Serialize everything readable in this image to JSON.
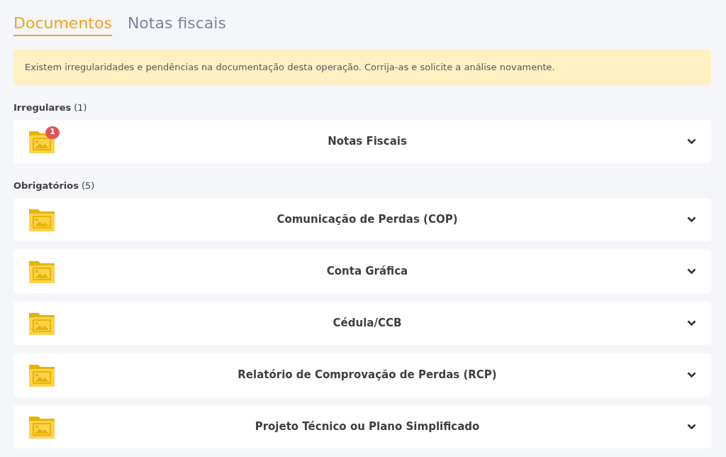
{
  "tabs": [
    {
      "label": "Documentos",
      "selected": true
    },
    {
      "label": "Notas fiscais",
      "selected": false
    }
  ],
  "alert": "Existem irregularidades e pendências na documentação desta operação. Corrija-as e solicite a análise novamente.",
  "sections": [
    {
      "title": "Irregulares",
      "count": "(1)",
      "items": [
        {
          "name": "Notas Fiscais",
          "badge": "1",
          "expanded": false
        }
      ]
    },
    {
      "title": "Obrigatórios",
      "count": "(5)",
      "items": [
        {
          "name": "Comunicação de Perdas (COP)",
          "expanded": false
        },
        {
          "name": "Conta Gráfica",
          "expanded": false
        },
        {
          "name": "Cédula/CCB",
          "expanded": false
        },
        {
          "name": "Relatório de Comprovação de Perdas (RCP)",
          "expanded": false
        },
        {
          "name": "Projeto Técnico ou Plano Simplificado",
          "expanded": false
        }
      ]
    }
  ]
}
